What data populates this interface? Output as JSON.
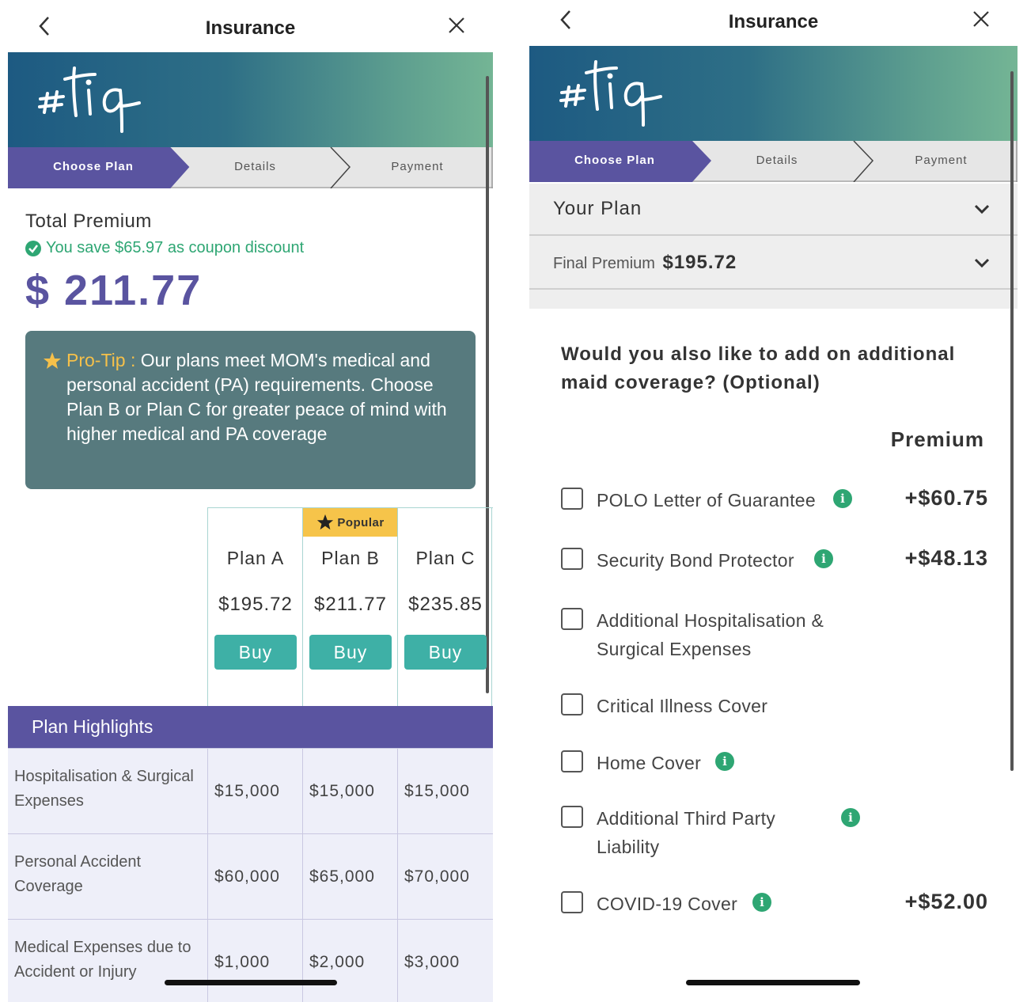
{
  "left": {
    "header": {
      "title": "Insurance"
    },
    "brand": {
      "logo_text": "#tiq"
    },
    "steps": [
      {
        "label": "Choose Plan",
        "active": true
      },
      {
        "label": "Details",
        "active": false
      },
      {
        "label": "Payment",
        "active": false
      }
    ],
    "premium": {
      "label": "Total Premium",
      "saving": "You save $65.97 as coupon discount",
      "amount": "$ 211.77"
    },
    "protip": {
      "head": "Pro-Tip :",
      "text": " Our plans meet MOM's medical and personal accident (PA) requirements. Choose Plan B or Plan C for greater peace of mind with higher medical and PA coverage"
    },
    "plans": [
      {
        "name": "Plan A",
        "price": "$195.72",
        "button": "Buy",
        "badge": ""
      },
      {
        "name": "Plan B",
        "price": "$211.77",
        "button": "Buy",
        "badge": "Popular"
      },
      {
        "name": "Plan C",
        "price": "$235.85",
        "button": "Buy",
        "badge": ""
      }
    ],
    "highlights": {
      "title": "Plan Highlights",
      "rows": [
        {
          "label": "Hospitalisation & Surgical Expenses",
          "values": [
            "$15,000",
            "$15,000",
            "$15,000"
          ]
        },
        {
          "label": "Personal Accident Coverage",
          "values": [
            "$60,000",
            "$65,000",
            "$70,000"
          ]
        },
        {
          "label": "Medical Expenses due to Accident or Injury",
          "values": [
            "$1,000",
            "$2,000",
            "$3,000"
          ]
        }
      ]
    }
  },
  "right": {
    "header": {
      "title": "Insurance"
    },
    "brand": {
      "logo_text": "#tiq"
    },
    "steps": [
      {
        "label": "Choose Plan",
        "active": true
      },
      {
        "label": "Details",
        "active": false
      },
      {
        "label": "Payment",
        "active": false
      }
    ],
    "your_plan": {
      "label": "Your Plan"
    },
    "final_premium": {
      "label": "Final Premium",
      "amount": "$195.72"
    },
    "question": "Would you also like to add on additional maid coverage? (Optional)",
    "premium_header": "Premium",
    "addons": [
      {
        "name": "POLO Letter of Guarantee",
        "price": "+$60.75",
        "info": true,
        "checked": false
      },
      {
        "name": "Security Bond Protector",
        "price": "+$48.13",
        "info": true,
        "checked": false
      },
      {
        "name": "Additional Hospitalisation & Surgical Expenses",
        "price": "",
        "info": false,
        "checked": false
      },
      {
        "name": "Critical Illness Cover",
        "price": "",
        "info": false,
        "checked": false
      },
      {
        "name": "Home Cover",
        "price": "",
        "info": true,
        "checked": false
      },
      {
        "name": "Additional Third Party Liability",
        "price": "",
        "info": true,
        "checked": false
      },
      {
        "name": "COVID-19 Cover",
        "price": "+$52.00",
        "info": true,
        "checked": false
      }
    ]
  },
  "colors": {
    "purple": "#5a54a0",
    "teal_button": "#3eb0a6",
    "green": "#2ea673",
    "protip_bg": "#577a7e",
    "popular": "#f6c44a"
  }
}
